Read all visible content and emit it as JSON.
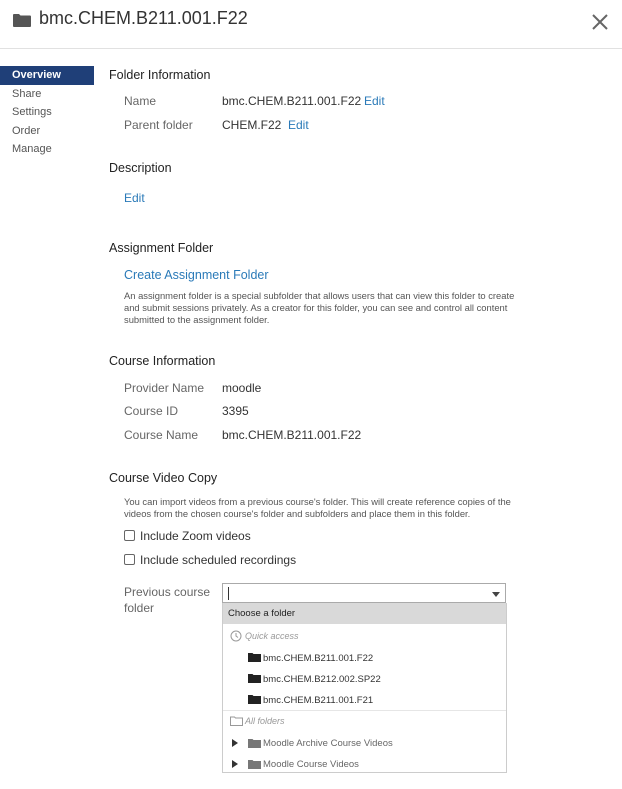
{
  "header": {
    "title": "bmc.CHEM.B211.001.F22",
    "icon": "folder-icon",
    "close_icon": "close-icon"
  },
  "nav": {
    "items": [
      "Overview",
      "Share",
      "Settings",
      "Order",
      "Manage"
    ],
    "active": "Overview"
  },
  "folder_info": {
    "heading": "Folder Information",
    "name_label": "Name",
    "name_value": "bmc.CHEM.B211.001.F22",
    "name_edit": "Edit",
    "parent_label": "Parent folder",
    "parent_value": "CHEM.F22",
    "parent_edit": "Edit"
  },
  "description": {
    "heading": "Description",
    "edit": "Edit"
  },
  "assignment": {
    "heading": "Assignment Folder",
    "create_link": "Create Assignment Folder",
    "text": "An assignment folder is a special subfolder that allows users that can view this folder to create and submit sessions privately. As a creator for this folder, you can see and control all content submitted to the assignment folder."
  },
  "course_info": {
    "heading": "Course Information",
    "provider_label": "Provider Name",
    "provider_value": "moodle",
    "id_label": "Course ID",
    "id_value": "3395",
    "coursename_label": "Course Name",
    "coursename_value": "bmc.CHEM.B211.001.F22"
  },
  "video_copy": {
    "heading": "Course Video Copy",
    "text": "You can import videos from a previous course's folder. This will create reference copies of the videos from the chosen course's folder and subfolders and place them in this folder.",
    "zoom_label": "Include Zoom videos",
    "scheduled_label": "Include scheduled recordings",
    "prev_label_line1": "Previous course",
    "prev_label_line2": "folder",
    "input_value": ""
  },
  "dropdown": {
    "choose": "Choose a folder",
    "quick_access_label": "Quick access",
    "quick_access": [
      "bmc.CHEM.B211.001.F22",
      "bmc.CHEM.B212.002.SP22",
      "bmc.CHEM.B211.001.F21"
    ],
    "all_folders_label": "All folders",
    "all_folders": [
      "Moodle Archive Course Videos",
      "Moodle Course Videos"
    ]
  },
  "colors": {
    "accent": "#1f3f78",
    "link": "#2a7ab8",
    "highlight": "#d9d9d9"
  }
}
